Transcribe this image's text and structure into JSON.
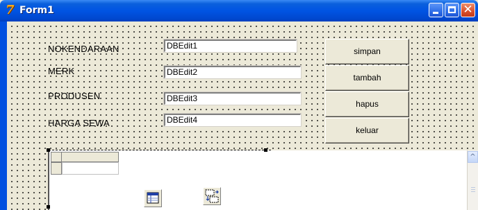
{
  "window": {
    "title": "Form1",
    "app_icon": "delphi-icon",
    "controls": {
      "minimize": "minimize-icon",
      "maximize": "maximize-icon",
      "close": "close-icon"
    }
  },
  "form": {
    "labels": [
      "NOKENDARAAN",
      "MERK",
      "PRODUSEN",
      "HARGA SEWA"
    ],
    "edits": [
      "DBEdit1",
      "DBEdit2",
      "DBEdit3",
      "DBEdit4"
    ],
    "buttons": {
      "simpan": "simpan",
      "tambah": "tambah",
      "hapus": "hapus",
      "keluar": "keluar"
    }
  },
  "components": [
    "datasource-component-icon",
    "table-component-icon"
  ],
  "colors": {
    "titlebar": "#0054e3",
    "form_bg": "#ece9d8",
    "close_button": "#d8502c"
  }
}
